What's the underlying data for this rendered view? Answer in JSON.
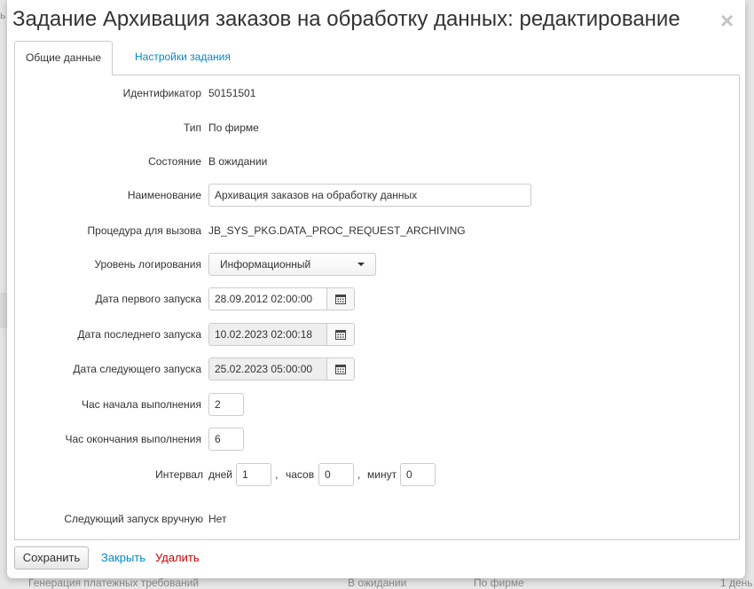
{
  "background": {
    "fragment_top": "ь",
    "fragment_bottom": "Генерация платежных требований",
    "fragment_status": "В ожидании",
    "fragment_type": "По фирме",
    "fragment_right": "1 день"
  },
  "modal": {
    "title": "Задание Архивация заказов на обработку данных: редактирование",
    "close_icon": "×"
  },
  "tabs": [
    {
      "label": "Общие данные",
      "active": true
    },
    {
      "label": "Настройки задания",
      "active": false
    }
  ],
  "form": {
    "id_label": "Идентификатор",
    "id_value": "50151501",
    "type_label": "Тип",
    "type_value": "По фирме",
    "state_label": "Состояние",
    "state_value": "В ожидании",
    "name_label": "Наименование",
    "name_value": "Архивация заказов на обработку данных",
    "proc_label": "Процедура для вызова",
    "proc_value": "JB_SYS_PKG.DATA_PROC_REQUEST_ARCHIVING",
    "log_label": "Уровень логирования",
    "log_value": "Информационный",
    "first_run_label": "Дата первого запуска",
    "first_run_value": "28.09.2012 02:00:00",
    "last_run_label": "Дата последнего запуска",
    "last_run_value": "10.02.2023 02:00:18",
    "next_run_label": "Дата следующего запуска",
    "next_run_value": "25.02.2023 05:00:00",
    "start_hour_label": "Час начала выполнения",
    "start_hour_value": "2",
    "end_hour_label": "Час окончания выполнения",
    "end_hour_value": "6",
    "interval_label": "Интервал",
    "days_label": "дней",
    "days_value": "1",
    "hours_label": "часов",
    "hours_value": "0",
    "minutes_label": "минут",
    "minutes_value": "0",
    "comma": ",",
    "manual_label": "Следующий запуск вручную",
    "manual_value": "Нет"
  },
  "footer": {
    "save": "Сохранить",
    "close": "Закрыть",
    "delete": "Удалить"
  },
  "colors": {
    "link": "#0088cc",
    "danger": "#cc0000",
    "disabled_bg": "#eeeeee"
  }
}
